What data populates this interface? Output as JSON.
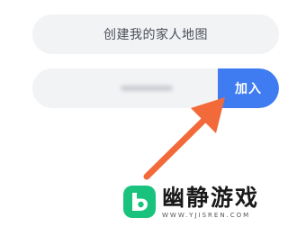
{
  "create_map_button": {
    "label": "创建我的家人地图"
  },
  "join_row": {
    "input_value": "",
    "join_label": "加入"
  },
  "watermark": {
    "name": "幽静游戏",
    "url": "WWW.YJISREN.COM"
  },
  "colors": {
    "primary": "#3f7cf2",
    "arrow": "#f26a3a",
    "pill_bg": "#f2f3f5",
    "logo_green": "#19c37d"
  },
  "icons": {
    "annotation_arrow": "arrow-up-right-icon",
    "logo": "brand-logo-icon"
  }
}
